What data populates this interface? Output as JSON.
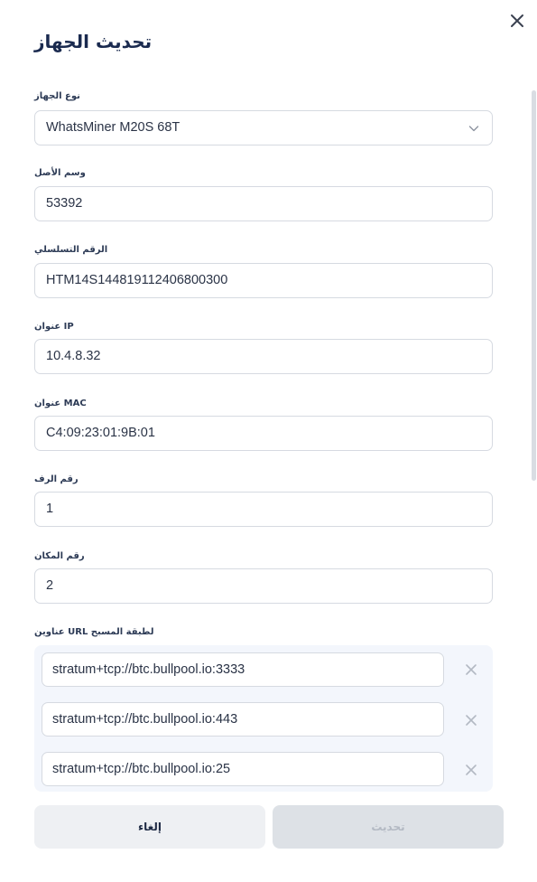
{
  "dialog": {
    "title": "تحديث الجهاز",
    "close_icon": "close-icon"
  },
  "fields": {
    "device_type": {
      "label": "نوع الجهاز",
      "value": "WhatsMiner M20S 68T",
      "icon": "chevron-down-icon"
    },
    "asset_tag": {
      "label": "وسم الأصل",
      "value": "53392"
    },
    "serial_number": {
      "label": "الرقم التسلسلي",
      "value": "HTM14S144819112406800300"
    },
    "ip_address": {
      "label": "عنوان IP",
      "value": "10.4.8.32"
    },
    "mac_address": {
      "label": "عنوان MAC",
      "value": "C4:09:23:01:9B:01"
    },
    "rack_number": {
      "label": "رقم الرف",
      "value": "1"
    },
    "position_number": {
      "label": "رقم المكان",
      "value": "2"
    }
  },
  "pools": {
    "label": "عناوين URL لطبقة المسبح",
    "items": [
      {
        "url": "stratum+tcp://btc.bullpool.io:3333"
      },
      {
        "url": "stratum+tcp://btc.bullpool.io:443"
      },
      {
        "url": "stratum+tcp://btc.bullpool.io:25"
      }
    ]
  },
  "footer": {
    "cancel_label": "إلغاء",
    "update_label": "تحديث"
  },
  "colors": {
    "title": "#1a2a4f",
    "pool_box_bg": "#f3f6fc",
    "update_disabled_bg": "#dde1e6",
    "cancel_bg": "#eef0f3"
  }
}
